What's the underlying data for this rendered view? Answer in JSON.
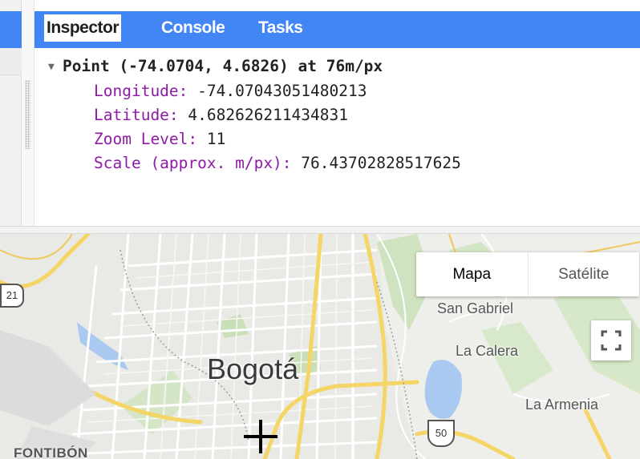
{
  "tabs": [
    {
      "label": "Inspector",
      "active": true
    },
    {
      "label": "Console",
      "active": false
    },
    {
      "label": "Tasks",
      "active": false
    }
  ],
  "inspector": {
    "header": "Point (-74.0704, 4.6826) at 76m/px",
    "properties": [
      {
        "key": "Longitude:",
        "value": "-74.07043051480213"
      },
      {
        "key": "Latitude:",
        "value": "4.682626211434831"
      },
      {
        "key": "Zoom Level:",
        "value": "11"
      },
      {
        "key": "Scale (approx. m/px):",
        "value": "76.43702828517625"
      }
    ]
  },
  "map": {
    "type_buttons": {
      "map": "Mapa",
      "satellite": "Satélite"
    },
    "labels": {
      "city": "Bogotá",
      "san_gabriel": "San Gabriel",
      "la_calera": "La Calera",
      "la_armenia": "La Armenia",
      "fontibon": "FONTIBÓN"
    },
    "shields": {
      "route_50": "50",
      "route_left": "21"
    },
    "icons": {
      "fullscreen": "fullscreen-icon",
      "crosshair": "crosshair-icon",
      "collapse": "triangle-down-icon"
    }
  },
  "colors": {
    "tab_bar": "#4285f4",
    "property_key": "#8e1aa7",
    "road_major": "#f5d565",
    "water": "#a9c9f0",
    "park": "#c9dfb8"
  }
}
